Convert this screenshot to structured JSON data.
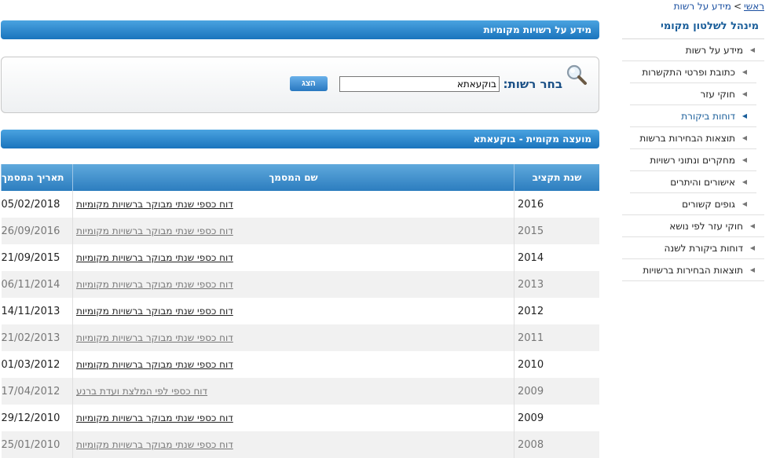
{
  "breadcrumb": {
    "home": "ראשי",
    "separator": ">",
    "current": "מידע על רשות"
  },
  "sidebar": {
    "title": "מינהל לשלטון מקומי",
    "items": [
      {
        "label": "מידע על רשות"
      },
      {
        "label": "כתובת ופרטי התקשרות"
      },
      {
        "label": "חוקי עזר"
      },
      {
        "label": "דוחות ביקורת"
      },
      {
        "label": "תוצאות הבחירות ברשות"
      },
      {
        "label": "מחקרים ונתוני רשויות"
      },
      {
        "label": "אישורים והיתרים"
      },
      {
        "label": "גופים קשורים"
      },
      {
        "label": "חוקי עזר לפי נושא"
      },
      {
        "label": "דוחות ביקורת לשנה"
      },
      {
        "label": "תוצאות הבחירות ברשויות"
      }
    ]
  },
  "main": {
    "header_title": "מידע על רשויות מקומיות",
    "search": {
      "label": "בחר רשות:",
      "value": "בוקעאתא",
      "button": "הצג"
    },
    "council_title": "מועצה מקומית - בוקעאתא",
    "table": {
      "headers": {
        "year": "שנת תקציב",
        "doc": "שם המסמך",
        "date": "תאריך המסמך"
      },
      "rows": [
        {
          "year": "2016",
          "doc": "דוח כספי שנתי מבוקר ברשויות מקומיות",
          "date": "05/02/2018"
        },
        {
          "year": "2015",
          "doc": "דוח כספי שנתי מבוקר ברשויות מקומיות",
          "date": "26/09/2016"
        },
        {
          "year": "2014",
          "doc": "דוח כספי שנתי מבוקר ברשויות מקומיות",
          "date": "21/09/2015"
        },
        {
          "year": "2013",
          "doc": "דוח כספי שנתי מבוקר ברשויות מקומיות",
          "date": "06/11/2014"
        },
        {
          "year": "2012",
          "doc": "דוח כספי שנתי מבוקר ברשויות מקומיות",
          "date": "14/11/2013"
        },
        {
          "year": "2011",
          "doc": "דוח כספי שנתי מבוקר ברשויות מקומיות",
          "date": "21/02/2013"
        },
        {
          "year": "2010",
          "doc": "דוח כספי שנתי מבוקר ברשויות מקומיות",
          "date": "01/03/2012"
        },
        {
          "year": "2009",
          "doc": "דוח כספי לפי המלצת ועדת ברנע",
          "date": "17/04/2012"
        },
        {
          "year": "2009",
          "doc": "דוח כספי שנתי מבוקר ברשויות מקומיות",
          "date": "29/12/2010"
        },
        {
          "year": "2008",
          "doc": "דוח כספי שנתי מבוקר ברשויות מקומיות",
          "date": "25/01/2010"
        }
      ]
    }
  },
  "colors": {
    "accent": "#1a74bd",
    "link": "#1a4fa0",
    "sidebar_title": "#1a5e9a"
  }
}
